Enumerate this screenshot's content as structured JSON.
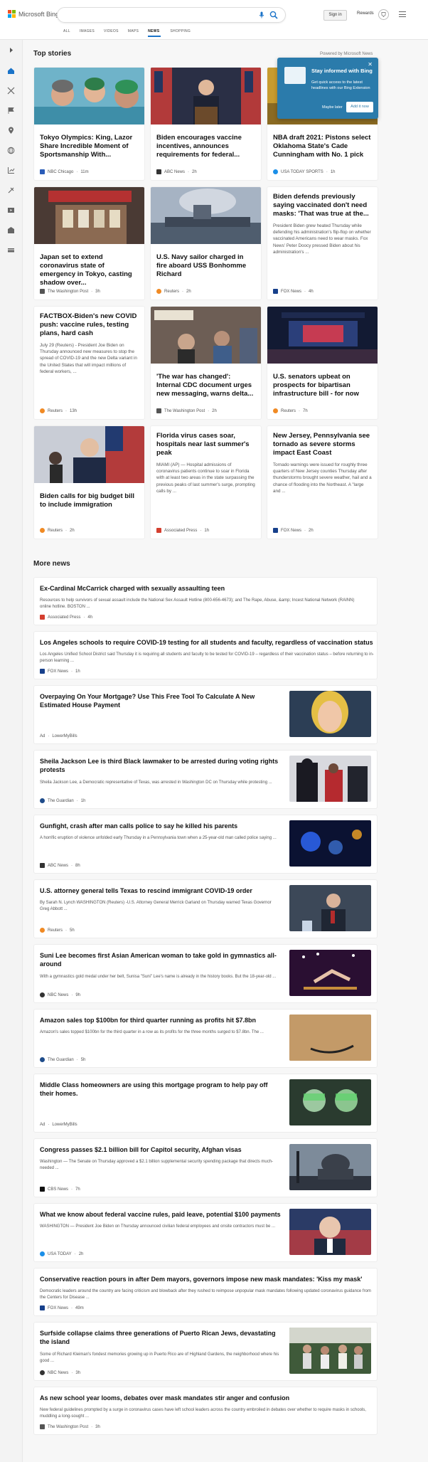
{
  "header": {
    "logo": "Microsoft Bing",
    "search_value": "",
    "signin": "Sign in",
    "rewards": "Rewards"
  },
  "tabs": [
    "ALL",
    "IMAGES",
    "VIDEOS",
    "MAPS",
    "NEWS",
    "SHOPPING"
  ],
  "active_tab": "NEWS",
  "top_stories": {
    "title": "Top stories",
    "powered": "Powered by Microsoft News",
    "cards": [
      {
        "title": "Tokyo Olympics: King, Lazor Share Incredible Moment of Sportsmanship With...",
        "snippet": "",
        "source": "NBC Chicago",
        "time": "11m",
        "image": "swimmers-icon"
      },
      {
        "title": "Biden encourages vaccine incentives, announces requirements for federal...",
        "snippet": "",
        "source": "ABC News",
        "time": "2h",
        "image": "podium-icon"
      },
      {
        "title": "NBA draft 2021: Pistons select Oklahoma State's Cade Cunningham with No. 1 pick",
        "snippet": "",
        "source": "USA TODAY SPORTS",
        "time": "1h",
        "image": "draft-icon"
      },
      {
        "title": "Japan set to extend coronavirus state of emergency in Tokyo, casting shadow over...",
        "snippet": "",
        "source": "The Washington Post",
        "time": "3h",
        "image": "shop-icon"
      },
      {
        "title": "U.S. Navy sailor charged in fire aboard USS Bonhomme Richard",
        "snippet": "",
        "source": "Reuters",
        "time": "2h",
        "image": "ship-icon"
      },
      {
        "title": "Biden defends previously saying vaccinated don't need masks: 'That was true at the...",
        "snippet": "President Biden grew heated Thursday while defending his administration's flip-flop on whether vaccinated Americans need to wear masks. Fox News' Peter Doocy pressed Biden about his administration's ...",
        "source": "FOX News",
        "time": "4h",
        "image": ""
      },
      {
        "title": "FACTBOX-Biden's new COVID push: vaccine rules, testing plans, hard cash",
        "snippet": "July 29 (Reuters) - President Joe Biden on Thursday announced new measures to stop the spread of COVID-19 and the new Delta variant in the United States that will impact millions of federal workers, ...",
        "source": "Reuters",
        "time": "13h",
        "image": ""
      },
      {
        "title": "'The war has changed': Internal CDC document urges new messaging, warns delta...",
        "snippet": "",
        "source": "The Washington Post",
        "time": "2h",
        "image": "hollywood-icon"
      },
      {
        "title": "U.S. senators upbeat on prospects for bipartisan infrastructure bill - for now",
        "snippet": "",
        "source": "Reuters",
        "time": "7h",
        "image": "exchange-icon"
      },
      {
        "title": "Biden calls for big budget bill to include immigration",
        "snippet": "",
        "source": "Reuters",
        "time": "2h",
        "image": "biden-flag-icon"
      },
      {
        "title": "Florida virus cases soar, hospitals near last summer's peak",
        "snippet": "MIAMI (AP) — Hospital admissions of coronavirus patients continue to soar in Florida with at least two areas in the state surpassing the previous peaks of last summer's surge, prompting calls by ...",
        "source": "Associated Press",
        "time": "1h",
        "image": ""
      },
      {
        "title": "New Jersey, Pennsylvania see tornado as severe storms impact East Coast",
        "snippet": "Tornado warnings were issued for roughly three quarters of New Jersey counties Thursday after thunderstorms brought severe weather, hail and a chance of flooding into the Northeast. A \"large and ...",
        "source": "FOX News",
        "time": "2h",
        "image": ""
      }
    ]
  },
  "popup": {
    "title": "Stay informed with Bing",
    "body": "Get quick access to the latest headlines with our Bing Extension",
    "later": "Maybe later",
    "add": "Add it now"
  },
  "more_news": {
    "title": "More news",
    "items": [
      {
        "title": "Ex-Cardinal McCarrick charged with sexually assaulting teen",
        "snippet": "Resources to help survivors of sexual assault include the National Sex Assault Hotline (800-656-4673); and The Rape, Abuse, &amp; Incest National Network (RAINN) online hotline. BOSTON ...",
        "source": "Associated Press",
        "time": "4h"
      },
      {
        "title": "Los Angeles schools to require COVID-19 testing for all students and faculty, regardless of vaccination status",
        "snippet": "Los Angeles Unified School District said Thursday it is requiring all students and faculty to be tested for COVID-19 – regardless of their vaccination status – before returning to in-person learning ...",
        "source": "FOX News",
        "time": "1h"
      },
      {
        "title": "Overpaying On Your Mortgage? Use This Free Tool To Calculate A New Estimated House Payment",
        "snippet": "",
        "source": "LowerMyBills",
        "time": "Ad"
      },
      {
        "title": "Sheila Jackson Lee is third Black lawmaker to be arrested during voting rights protests",
        "snippet": "Sheila Jackson Lee, a Democratic representative of Texas, was arrested in Washington DC on Thursday while protesting ...",
        "source": "The Guardian",
        "time": "1h"
      },
      {
        "title": "Gunfight, crash after man calls police to say he killed his parents",
        "snippet": "A horrific eruption of violence unfolded early Thursday in a Pennsylvania town when a 25-year-old man called police saying ...",
        "source": "ABC News",
        "time": "8h"
      },
      {
        "title": "U.S. attorney general tells Texas to rescind immigrant COVID-19 order",
        "snippet": "By Sarah N. Lynch WASHINGTON (Reuters) -U.S. Attorney General Merrick Garland on Thursday warned Texas Governor Greg Abbott ...",
        "source": "Reuters",
        "time": "5h"
      },
      {
        "title": "Suni Lee becomes first Asian American woman to take gold in gymnastics all-around",
        "snippet": "With a gymnastics gold medal under her belt, Sunisa \"Suni\" Lee's name is already in the history books. But the 18-year-old ...",
        "source": "NBC News",
        "time": "9h"
      },
      {
        "title": "Amazon sales top $100bn for third quarter running as profits hit $7.8bn",
        "snippet": "Amazon's sales topped $100bn for the third quarter in a row as its profits for the three months surged to $7.8bn. The ...",
        "source": "The Guardian",
        "time": "5h"
      },
      {
        "title": "Middle Class homeowners are using this mortgage program to help pay off their homes.",
        "snippet": "",
        "source": "LowerMyBills",
        "time": "Ad"
      },
      {
        "title": "Congress passes $2.1 billion bill for Capitol security, Afghan visas",
        "snippet": "Washington — The Senate on Thursday approved a $2.1 billion supplemental security spending package that directs much-needed ...",
        "source": "CBS News",
        "time": "7h"
      },
      {
        "title": "What we know about federal vaccine rules, paid leave, potential $100 payments",
        "snippet": "WASHINGTON — President Joe Biden on Thursday announced civilian federal employees and onsite contractors must be ...",
        "source": "USA TODAY",
        "time": "2h"
      },
      {
        "title": "Conservative reaction pours in after Dem mayors, governors impose new mask mandates: 'Kiss my mask'",
        "snippet": "Democratic leaders around the country are facing criticism and blowback after they rushed to reimpose unpopular mask mandates following updated coronavirus guidance from the Centers for Disease ...",
        "source": "FOX News",
        "time": "49m"
      },
      {
        "title": "Surfside collapse claims three generations of Puerto Rican Jews, devastating the island",
        "snippet": "Some of Richard Kleiman's fondest memories growing up in Puerto Rico are of Highland Gardens, the neighborhood where his good ...",
        "source": "NBC News",
        "time": "3h"
      },
      {
        "title": "As new school year looms, debates over mask mandates stir anger and confusion",
        "snippet": "New federal guidelines prompted by a surge in coronavirus cases have left school leaders across the country embroiled in debates over whether to require masks in schools, muddling a long-sought ...",
        "source": "The Washington Post",
        "time": "3h"
      }
    ]
  }
}
